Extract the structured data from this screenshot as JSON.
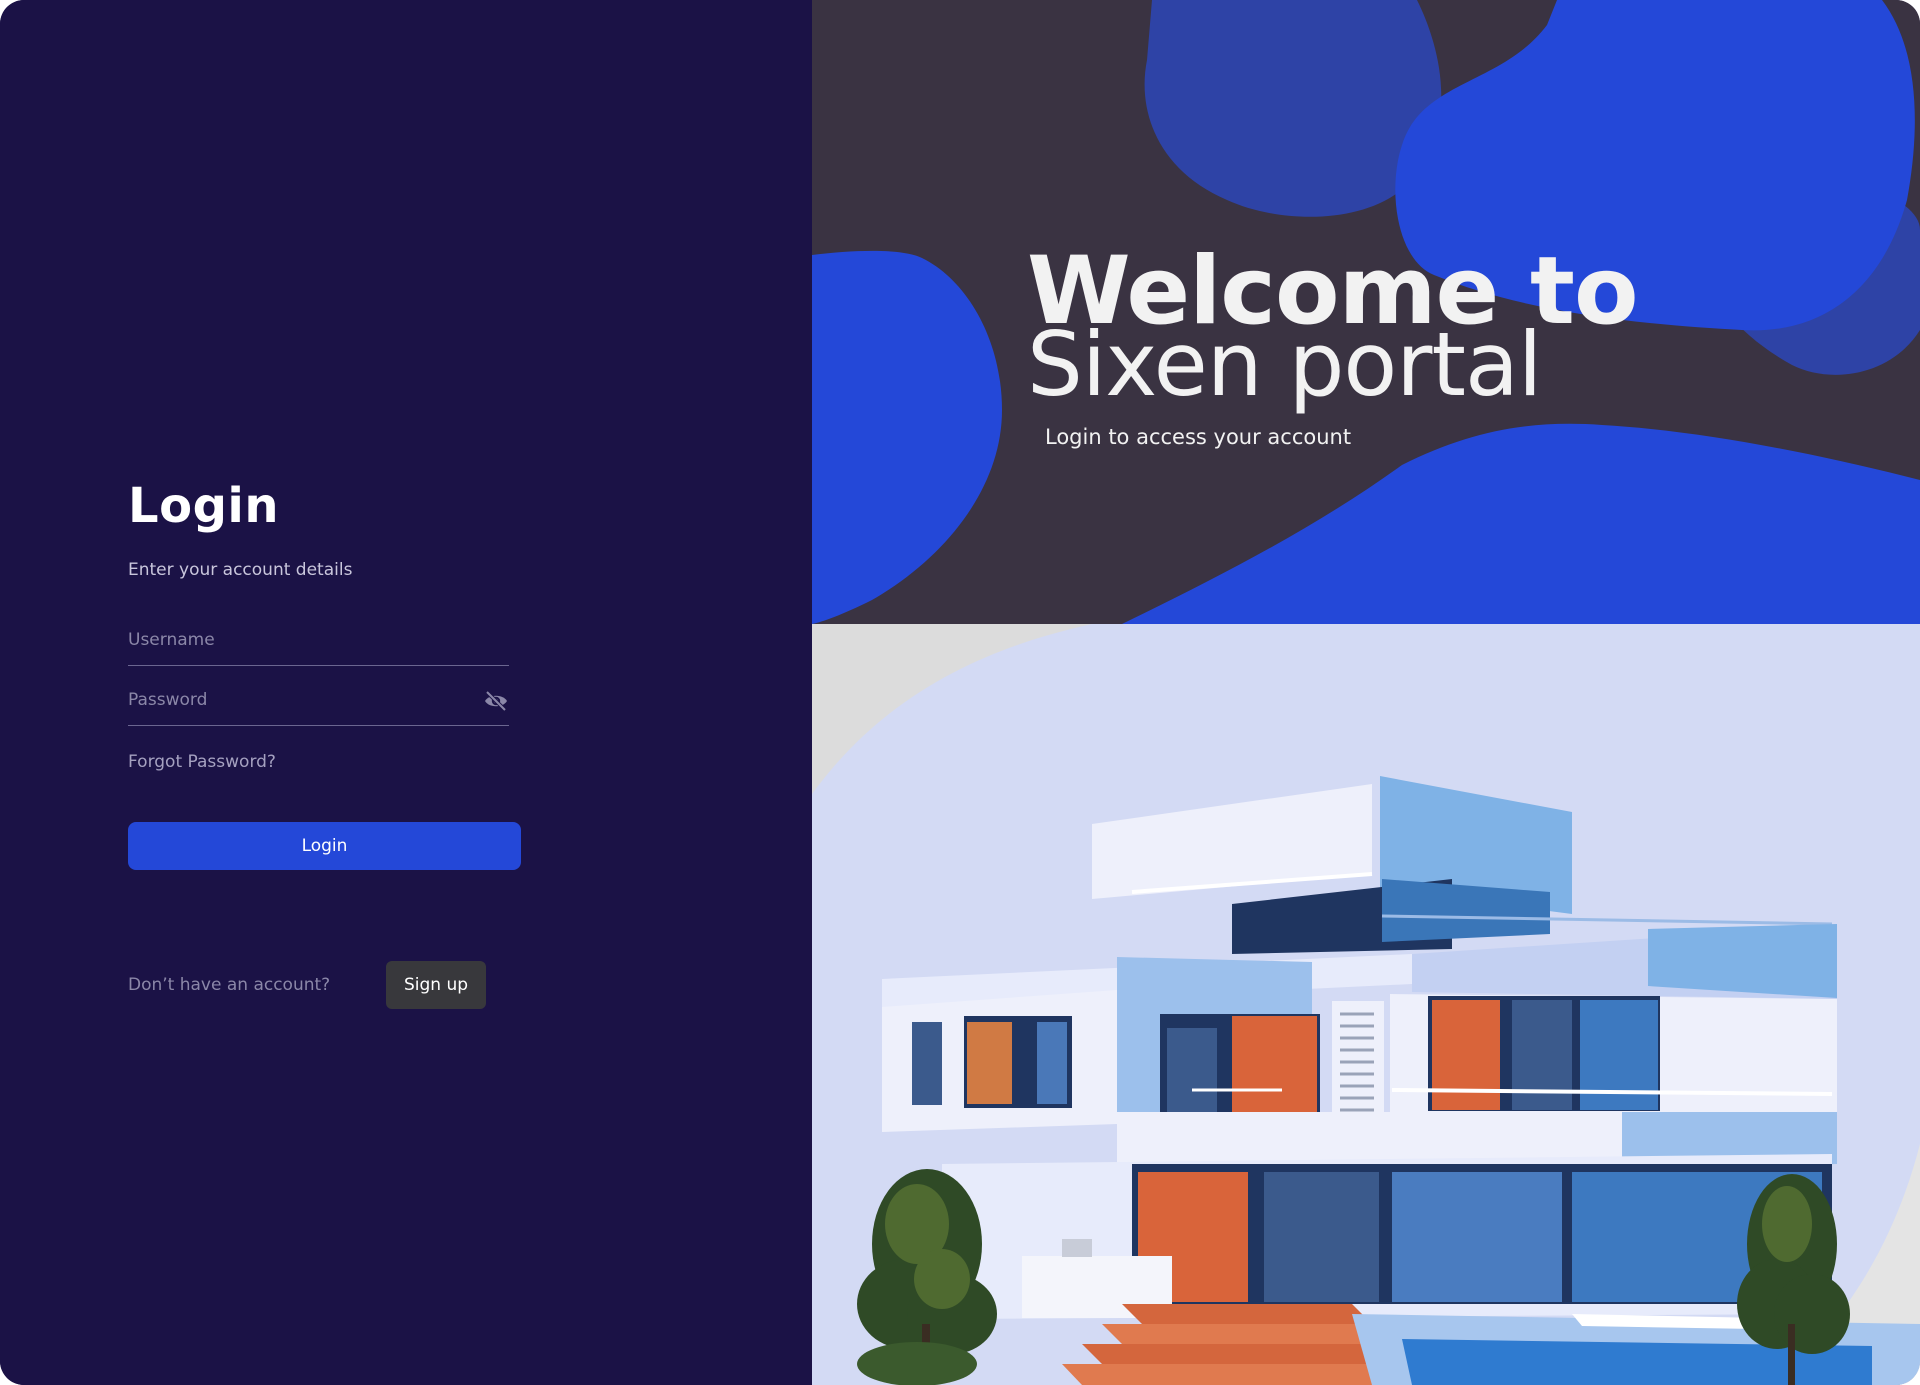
{
  "login": {
    "title": "Login",
    "subtitle": "Enter your account details",
    "username_placeholder": "Username",
    "password_placeholder": "Password",
    "forgot_password": "Forgot Password?",
    "login_button": "Login",
    "no_account_text": "Don’t have an account?",
    "signup_button": "Sign up",
    "password_toggle_icon": "eye-off-icon"
  },
  "hero": {
    "title_line1": "Welcome to",
    "title_line2": "Sixen portal",
    "tagline": "Login to access your account"
  },
  "illustration": {
    "subject": "modern-house-illustration"
  },
  "colors": {
    "left_background": "#1b1246",
    "accent_blue": "#2448d8",
    "hero_background": "#3a3342",
    "illustration_background": "#d3daf4",
    "signup_button": "#38383c"
  }
}
